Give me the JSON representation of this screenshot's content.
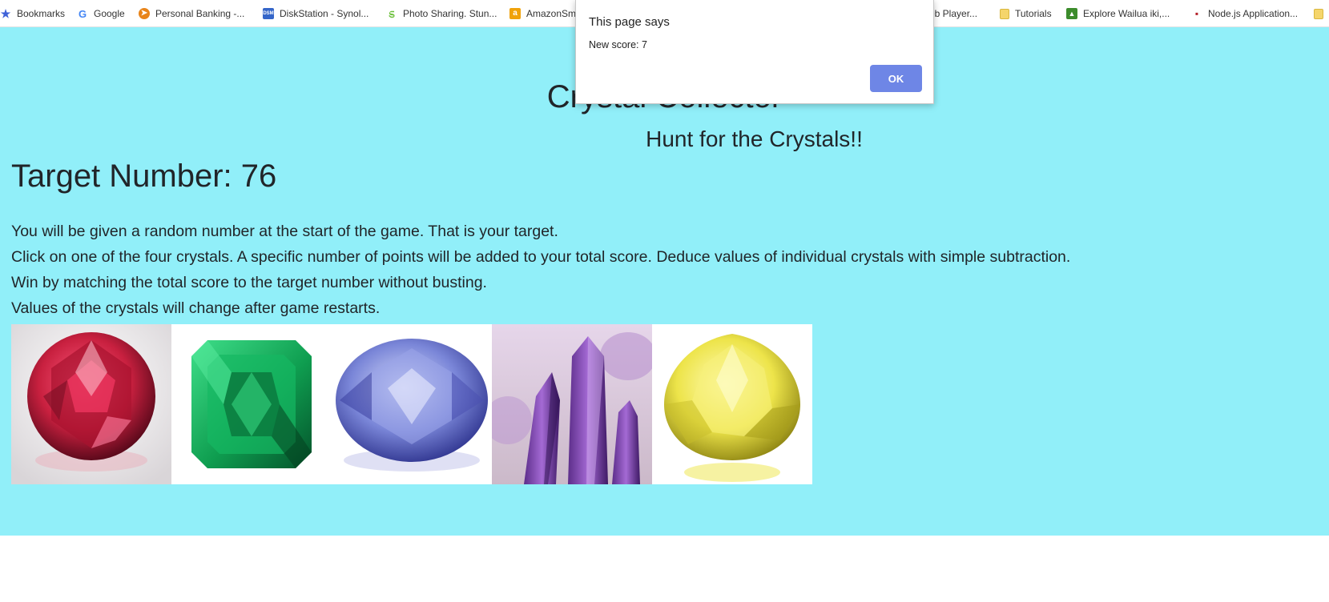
{
  "bookmarks": [
    {
      "label": "Bookmarks",
      "icon": "star-icon",
      "color": "#3f62d8"
    },
    {
      "label": "Google",
      "icon": "google-icon",
      "color": "#4285f4"
    },
    {
      "label": "Personal Banking -...",
      "icon": "banking-icon",
      "color": "#e8841a"
    },
    {
      "label": "DiskStation - Synol...",
      "icon": "dsm-icon",
      "color": "#3566c9"
    },
    {
      "label": "Photo Sharing. Stun...",
      "icon": "smugmug-icon",
      "color": "#6cbf3c"
    },
    {
      "label": "AmazonSm",
      "icon": "amazon-icon",
      "color": "#f0a20a"
    },
    {
      "label": "eb Player...",
      "icon": "",
      "color": ""
    },
    {
      "label": "Tutorials",
      "icon": "folder-icon",
      "color": "#f5d56b"
    },
    {
      "label": "Explore Wailua iki,...",
      "icon": "alltrails-icon",
      "color": "#3c8c2c"
    },
    {
      "label": "Node.js Application...",
      "icon": "nodejs-icon",
      "color": "#b31f27"
    }
  ],
  "page": {
    "title": "Crystal Collector",
    "subtitle": "Hunt for the Crystals!!",
    "target_label": "Target Number: 76",
    "instructions": [
      "You will be given a random number at the start of the game. That is your target.",
      "Click on one of the four crystals. A specific number of points will be added to your total score. Deduce values of individual crystals with simple subtraction.",
      "Win by matching the total score to the target number without busting.",
      "Values of the crystals will change after game restarts."
    ],
    "background": "#91eff9"
  },
  "crystals": [
    {
      "name": "ruby",
      "color": "#c8203f"
    },
    {
      "name": "emerald",
      "color": "#12a557"
    },
    {
      "name": "sapphire",
      "color": "#7a86d8"
    },
    {
      "name": "amethyst",
      "color": "#9b5fc4"
    },
    {
      "name": "citrine",
      "color": "#ede44a"
    }
  ],
  "dialog": {
    "title": "This page says",
    "message": "New score: 7",
    "ok_label": "OK",
    "ok_color": "#6e86e6"
  }
}
